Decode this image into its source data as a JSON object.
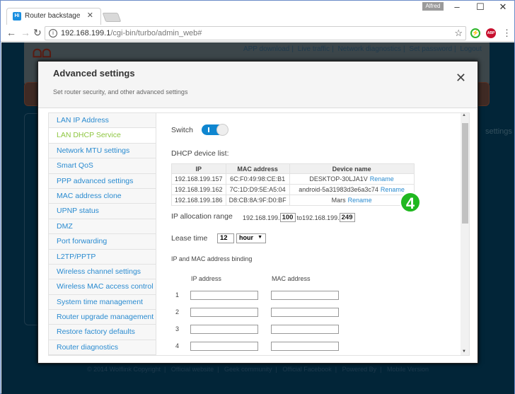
{
  "browser": {
    "tab_title": "Router backstage",
    "tab_favicon": "Hi",
    "profile_name": "Alfred",
    "url_host": "192.168.199.1",
    "url_path": "/cgi-bin/turbo/admin_web#"
  },
  "background": {
    "header_links": [
      "APP download",
      "Live traffic",
      "Network diagnostics",
      "Set password",
      "Logout"
    ],
    "right_label": "settings",
    "footer_links": [
      "© 2014 Wolflink Copyright",
      "Official website",
      "Geek community",
      "Official Facebook",
      "Powered By",
      "Mobile Version"
    ]
  },
  "modal": {
    "title": "Advanced settings",
    "subtitle": "Set router security, and other advanced settings",
    "nav_items": [
      "LAN IP Address",
      "LAN DHCP Service",
      "Network MTU settings",
      "Smart QoS",
      "PPP advanced settings",
      "MAC address clone",
      "UPNP status",
      "DMZ",
      "Port forwarding",
      "L2TP/PPTP",
      "Wireless channel settings",
      "Wireless MAC access control",
      "System time management",
      "Router upgrade management",
      "Restore factory defaults",
      "Router diagnostics"
    ],
    "active_nav": "LAN DHCP Service",
    "switch_label": "Switch",
    "switch_on": true,
    "device_list_label": "DHCP device list:",
    "device_table": {
      "headers": [
        "IP",
        "MAC address",
        "Device name"
      ],
      "rows": [
        {
          "ip": "192.168.199.157",
          "mac": "6C:F0:49:98:CE:B1",
          "name": "DESKTOP-30LJA1V",
          "action": "Rename"
        },
        {
          "ip": "192.168.199.162",
          "mac": "7C:1D:D9:5E:A5:04",
          "name": "android-5a31983d3e6a3c74",
          "action": "Rename"
        },
        {
          "ip": "192.168.199.186",
          "mac": "D8:CB:8A:9F:D0:BF",
          "name": "Mars",
          "action": "Rename"
        }
      ]
    },
    "ip_range": {
      "label": "IP allocation range",
      "prefix1": "192.168.199.",
      "start": "100",
      "to_text": "to192.168.199.",
      "end": "249"
    },
    "lease": {
      "label": "Lease time",
      "value": "12",
      "unit": "hour"
    },
    "binding": {
      "title": "IP and MAC address binding",
      "col_ip": "IP address",
      "col_mac": "MAC address",
      "rows": [
        "1",
        "2",
        "3",
        "4"
      ]
    }
  },
  "annotation_badge": "4"
}
